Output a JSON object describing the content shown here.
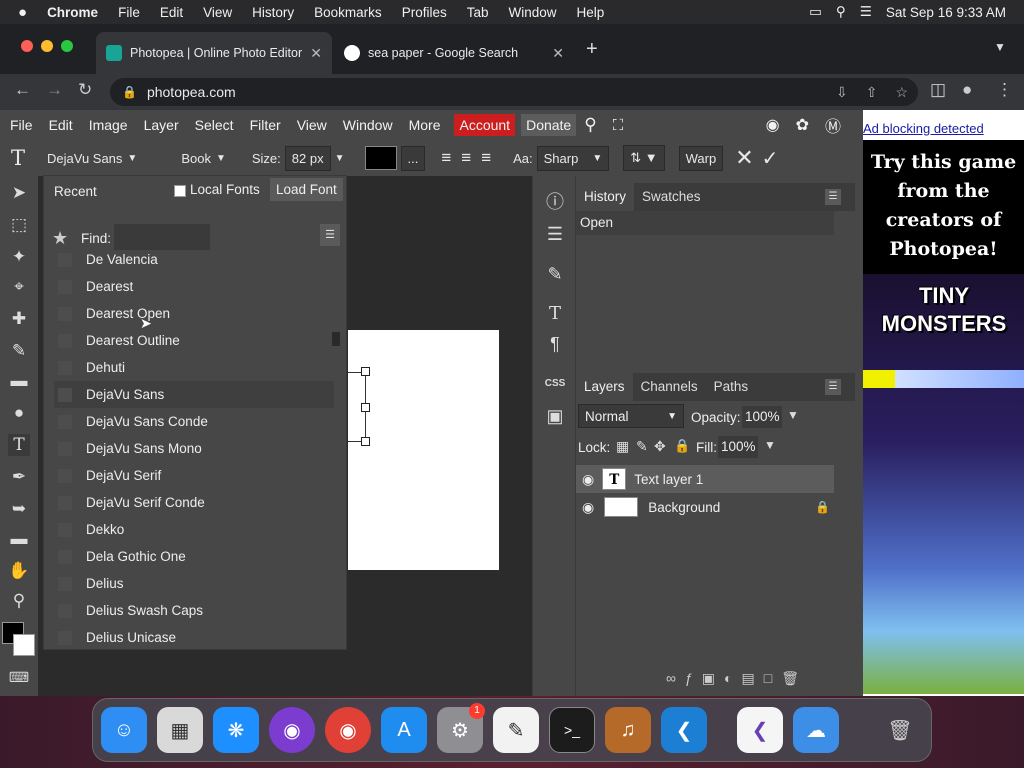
{
  "macbar": {
    "apple": "",
    "app": "Chrome",
    "menus": [
      "File",
      "Edit",
      "View",
      "History",
      "Bookmarks",
      "Profiles",
      "Tab",
      "Window",
      "Help"
    ],
    "datetime": "Sat Sep 16  9:33 AM"
  },
  "tabs": [
    {
      "title": "Photopea | Online Photo Editor",
      "active": true
    },
    {
      "title": "sea paper - Google Search",
      "active": false
    }
  ],
  "address": {
    "url": "photopea.com"
  },
  "pp_menu": {
    "items": [
      "File",
      "Edit",
      "Image",
      "Layer",
      "Select",
      "Filter",
      "View",
      "Window",
      "More"
    ],
    "account": "Account",
    "donate": "Donate"
  },
  "options": {
    "font": "DejaVu Sans",
    "style": "Book",
    "size_label": "Size:",
    "size_value": "82 px",
    "more": "...",
    "aa_label": "Aa:",
    "aa_value": "Sharp",
    "warp": "Warp"
  },
  "fontpanel": {
    "recent": "Recent",
    "local_fonts": "Local Fonts",
    "load_font": "Load Font",
    "find_label": "Find:",
    "find_value": "",
    "fonts": [
      "De Valencia",
      "Dearest",
      "Dearest Open",
      "Dearest Outline",
      "Dehuti",
      "DejaVu Sans",
      "DejaVu Sans Conde",
      "DejaVu Sans Mono",
      "DejaVu Serif",
      "DejaVu Serif Conde",
      "Dekko",
      "Dela Gothic One",
      "Delius",
      "Delius Swash Caps",
      "Delius Unicase"
    ],
    "highlighted": "DejaVu Sans"
  },
  "history": {
    "tabs": [
      "History",
      "Swatches"
    ],
    "items": [
      "Open"
    ]
  },
  "layers": {
    "tabs": [
      "Layers",
      "Channels",
      "Paths"
    ],
    "blend": "Normal",
    "opacity_label": "Opacity:",
    "opacity": "100%",
    "lock_label": "Lock:",
    "fill_label": "Fill:",
    "fill": "100%",
    "rows": [
      {
        "name": "Text layer 1"
      },
      {
        "name": "Background"
      }
    ]
  },
  "ad": {
    "notice": "Ad blocking detected",
    "headline": "Try this game from the creators of Photopea!",
    "game": "TINY MONSTERS"
  },
  "colors": {
    "account_bg": "#cc1e1e",
    "panel_bg": "#474747",
    "workspace_bg": "#2b2b2b"
  }
}
